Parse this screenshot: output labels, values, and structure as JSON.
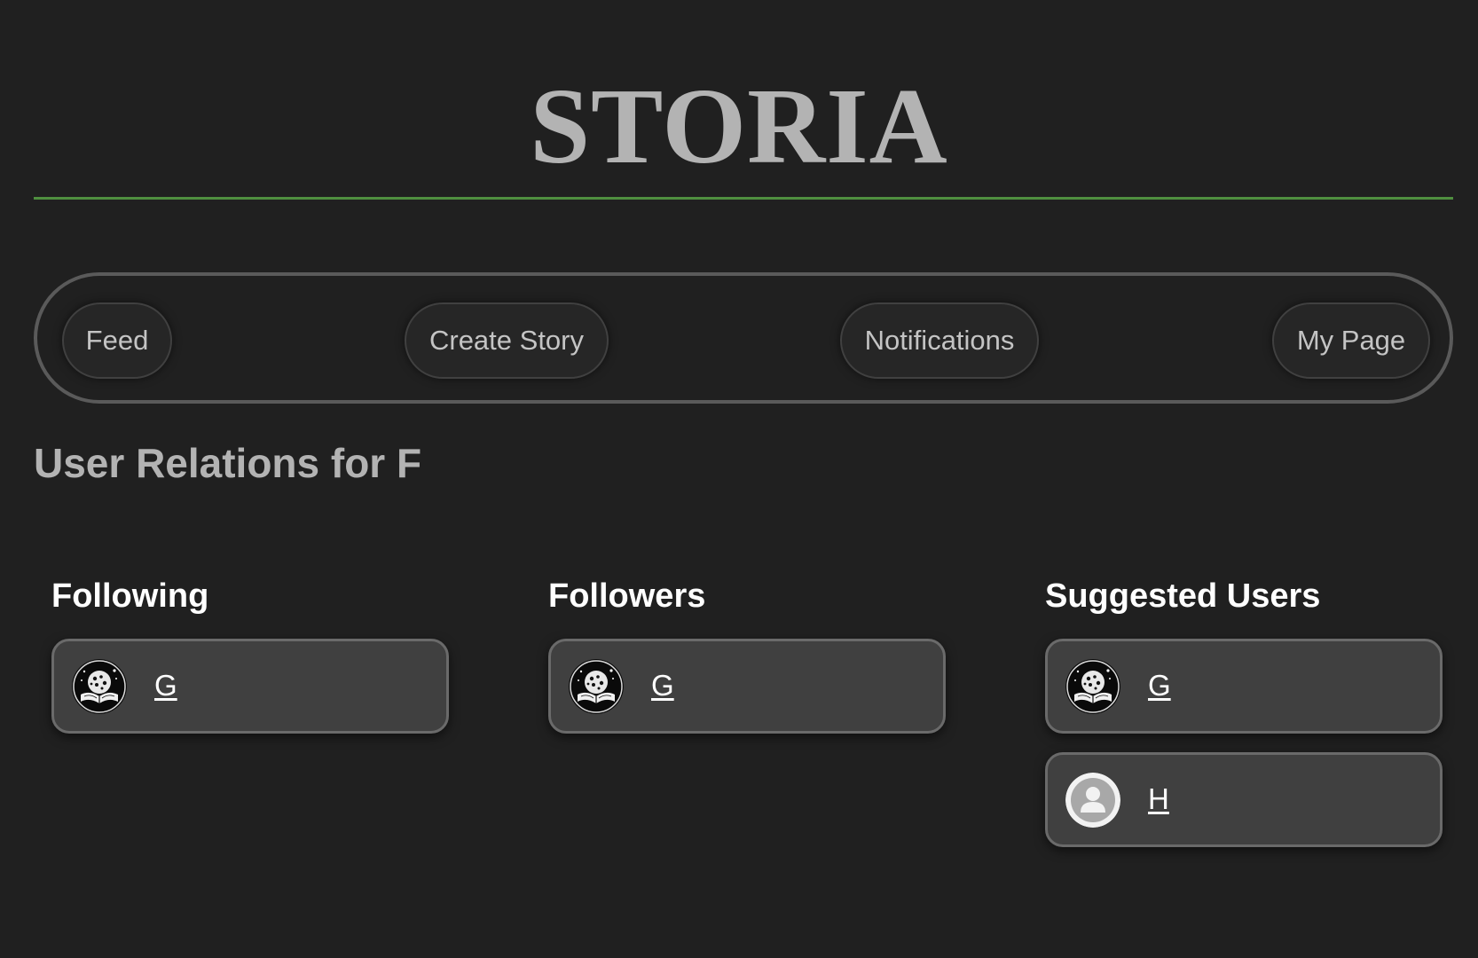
{
  "site": {
    "title": "STORIA",
    "accent_color": "#4f8f3f"
  },
  "nav": {
    "items": [
      {
        "label": "Feed"
      },
      {
        "label": "Create Story"
      },
      {
        "label": "Notifications"
      },
      {
        "label": "My Page"
      }
    ]
  },
  "relations": {
    "heading": "User Relations for F",
    "following": {
      "heading": "Following",
      "users": [
        {
          "name": "G",
          "avatar": "book-galaxy-avatar-icon"
        }
      ]
    },
    "followers": {
      "heading": "Followers",
      "users": [
        {
          "name": "G",
          "avatar": "book-galaxy-avatar-icon"
        }
      ]
    },
    "suggested": {
      "heading": "Suggested Users",
      "users": [
        {
          "name": "G",
          "avatar": "book-galaxy-avatar-icon"
        },
        {
          "name": "H",
          "avatar": "default-user-avatar-icon"
        }
      ]
    }
  }
}
